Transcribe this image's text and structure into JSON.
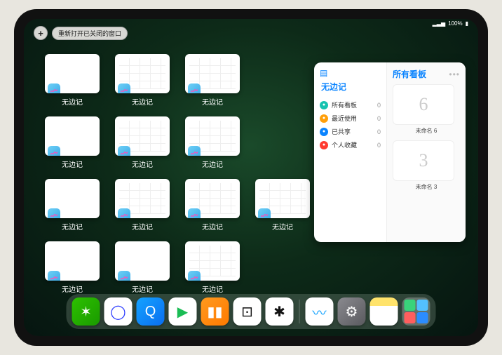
{
  "status": {
    "battery": "100%",
    "signal": "▂▃▅"
  },
  "topbar": {
    "plus": "+",
    "reopen_label": "重新打开已关闭的窗口"
  },
  "thumbs": {
    "label": "无边记",
    "items": [
      {
        "style": "blank"
      },
      {
        "style": "grid"
      },
      {
        "style": "grid"
      },
      {
        "style": "blank"
      },
      {
        "style": "grid"
      },
      {
        "style": "grid"
      },
      {
        "style": "blank"
      },
      {
        "style": "grid"
      },
      {
        "style": "grid"
      },
      {
        "style": "grid"
      },
      {
        "style": "blank"
      },
      {
        "style": "blank"
      },
      {
        "style": "grid"
      }
    ]
  },
  "panel": {
    "app_title": "无边记",
    "nav": [
      {
        "icon_color": "#16c3b0",
        "label": "所有看板",
        "count": 0
      },
      {
        "icon_color": "#ff9f0a",
        "label": "最近使用",
        "count": 0
      },
      {
        "icon_color": "#0a84ff",
        "label": "已共享",
        "count": 0
      },
      {
        "icon_color": "#ff3b30",
        "label": "个人收藏",
        "count": 0
      }
    ],
    "right_title": "所有看板",
    "boards": [
      {
        "glyph": "6",
        "title": "未命名 6",
        "subtitle": ""
      },
      {
        "glyph": "3",
        "title": "未命名 3",
        "subtitle": ""
      }
    ]
  },
  "dock": [
    {
      "name": "wechat",
      "bg": "linear-gradient(135deg,#2dc100,#1a9a00)",
      "glyph": "✶"
    },
    {
      "name": "browser-1",
      "bg": "#fff",
      "glyph": "◯",
      "fg": "#2c3cff"
    },
    {
      "name": "browser-2",
      "bg": "linear-gradient(135deg,#14a3ff,#0a6ef0)",
      "glyph": "Q"
    },
    {
      "name": "play",
      "bg": "#fff",
      "glyph": "▶",
      "fg": "#1abc54"
    },
    {
      "name": "books",
      "bg": "linear-gradient(135deg,#ff9a1f,#ff7a00)",
      "glyph": "▮▮"
    },
    {
      "name": "dice",
      "bg": "#fff",
      "glyph": "⊡",
      "fg": "#111"
    },
    {
      "name": "nodes",
      "bg": "#fff",
      "glyph": "✱",
      "fg": "#111"
    },
    {
      "name": "freeform",
      "bg": "#fff",
      "glyph": "〰",
      "fg": "#14a3ff"
    },
    {
      "name": "settings",
      "bg": "linear-gradient(135deg,#8a8a8f,#5a5a5f)",
      "glyph": "⚙"
    },
    {
      "name": "notes",
      "bg": "linear-gradient(#ffe36b 30%,#fff 30%)",
      "glyph": "",
      "fg": "#333"
    }
  ],
  "dock_group_colors": [
    "#39d37a",
    "#53c0ff",
    "#ff5e5e",
    "#2b8cff"
  ]
}
